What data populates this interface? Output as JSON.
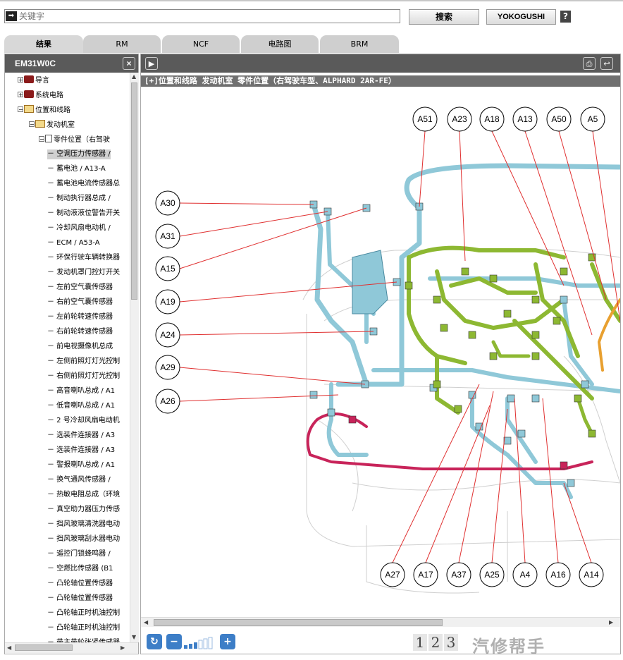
{
  "search": {
    "placeholder": "关键字",
    "key_icon_glyph": "➡",
    "search_button": "搜索",
    "yokogushi_button": "YOKOGUSHI",
    "help_button": "?"
  },
  "tabs": [
    {
      "label": "结果"
    },
    {
      "label": "RM"
    },
    {
      "label": "NCF"
    },
    {
      "label": "电路图"
    },
    {
      "label": "BRM"
    }
  ],
  "left_panel": {
    "title": "EM31W0C",
    "close_glyph": "×",
    "tree": [
      {
        "label": "导言",
        "level": 1,
        "type": "book",
        "expander": "+"
      },
      {
        "label": "系统电路",
        "level": 1,
        "type": "book",
        "expander": "+"
      },
      {
        "label": "位置和线路",
        "level": 1,
        "type": "openbook",
        "expander": "−"
      },
      {
        "label": "发动机室",
        "level": 2,
        "type": "openbook",
        "expander": "−"
      },
      {
        "label": "零件位置（右驾驶",
        "level": 3,
        "type": "doc",
        "expander": "−"
      },
      {
        "label": "－ 空调压力传感器 /",
        "level": 4,
        "selected": true
      },
      {
        "label": "－ 蓄电池 / A13-A",
        "level": 4
      },
      {
        "label": "－ 蓄电池电流传感器总",
        "level": 4
      },
      {
        "label": "－ 制动执行器总成 /",
        "level": 4
      },
      {
        "label": "－ 制动液液位警告开关",
        "level": 4
      },
      {
        "label": "－ 冷却风扇电动机 /",
        "level": 4
      },
      {
        "label": "－ ECM / A53-A",
        "level": 4
      },
      {
        "label": "－ 环保行驶车辆转换器",
        "level": 4
      },
      {
        "label": "－ 发动机罩门控灯开关",
        "level": 4
      },
      {
        "label": "－ 左前空气囊传感器",
        "level": 4
      },
      {
        "label": "－ 右前空气囊传感器",
        "level": 4
      },
      {
        "label": "－ 左前轮转速传感器",
        "level": 4
      },
      {
        "label": "－ 右前轮转速传感器",
        "level": 4
      },
      {
        "label": "－ 前电视摄像机总成",
        "level": 4
      },
      {
        "label": "－ 左侧前照灯灯光控制",
        "level": 4
      },
      {
        "label": "－ 右侧前照灯灯光控制",
        "level": 4
      },
      {
        "label": "－ 高音喇叭总成 / A1",
        "level": 4
      },
      {
        "label": "－ 低音喇叭总成 / A1",
        "level": 4
      },
      {
        "label": "－ 2 号冷却风扇电动机",
        "level": 4
      },
      {
        "label": "－ 选装件连接器 / A3",
        "level": 4
      },
      {
        "label": "－ 选装件连接器 / A3",
        "level": 4
      },
      {
        "label": "－ 警报喇叭总成 / A1",
        "level": 4
      },
      {
        "label": "－ 换气通风传感器 /",
        "level": 4
      },
      {
        "label": "－ 热敏电阻总成（环境",
        "level": 4
      },
      {
        "label": "－ 真空助力器压力传感",
        "level": 4
      },
      {
        "label": "－ 挡风玻璃清洗器电动",
        "level": 4
      },
      {
        "label": "－ 挡风玻璃刮水器电动",
        "level": 4
      },
      {
        "label": "－ 遥控门锁蜂鸣器 /",
        "level": 4
      },
      {
        "label": "－ 空燃比传感器 (B1",
        "level": 4
      },
      {
        "label": "－ 凸轮轴位置传感器",
        "level": 4
      },
      {
        "label": "－ 凸轮轴位置传感器",
        "level": 4
      },
      {
        "label": "－ 凸轮轴正时机油控制",
        "level": 4
      },
      {
        "label": "－ 凸轮轴正时机油控制",
        "level": 4
      },
      {
        "label": "－ 带主带轮张紧传感器",
        "level": 4
      }
    ]
  },
  "right_panel": {
    "play_glyph": "▶",
    "print_glyph": "⎙",
    "back_glyph": "↩",
    "doc_title": "[+]位置和线路  发动机室  零件位置（右驾驶车型、ALPHARD 2AR-FE）",
    "callouts_top": [
      "A51",
      "A23",
      "A18",
      "A13",
      "A50",
      "A5"
    ],
    "callouts_left": [
      "A30",
      "A31",
      "A15",
      "A19",
      "A24",
      "A29",
      "A26"
    ],
    "callouts_bottom": [
      "A27",
      "A17",
      "A37",
      "A25",
      "A4",
      "A16",
      "A14"
    ],
    "colors": {
      "harness_blue": "#8fc8d8",
      "harness_green": "#8db832",
      "harness_red": "#c8245a",
      "harness_orange": "#e8a030",
      "leader": "#e03030"
    },
    "zoom_glyphs": {
      "refresh": "↻",
      "zoom_out": "−",
      "zoom_in": "+"
    },
    "pages": [
      "1",
      "2",
      "3"
    ],
    "watermark": "汽修帮手"
  }
}
